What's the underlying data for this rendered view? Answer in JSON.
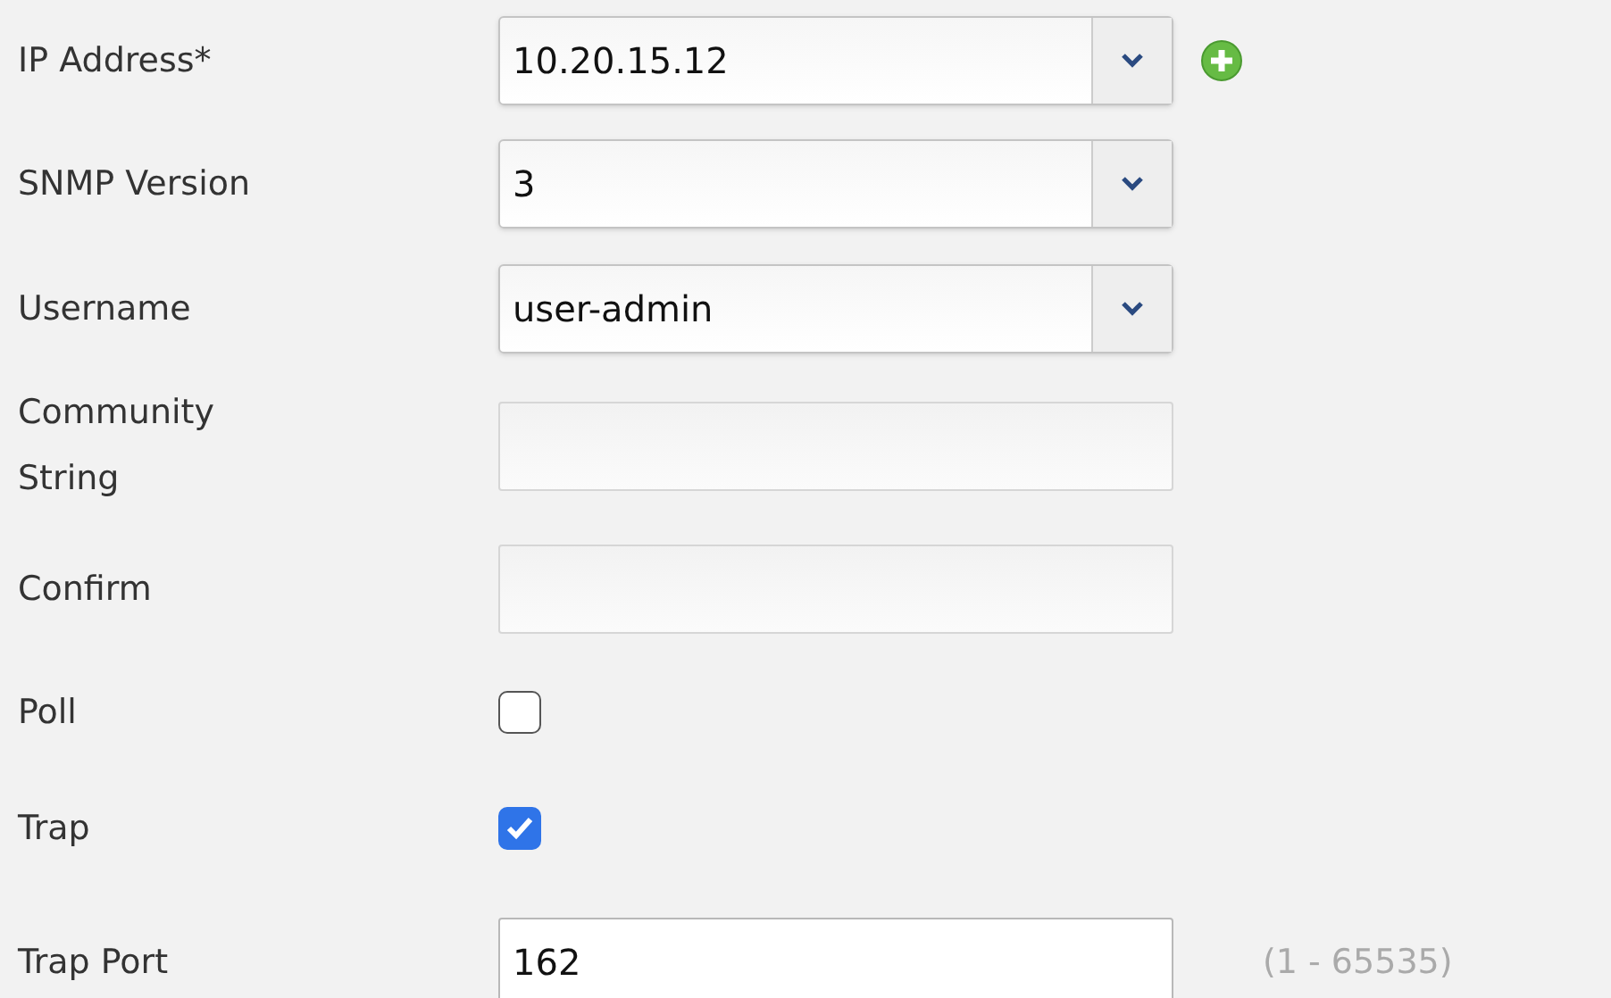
{
  "fields": [
    {
      "kind": "combo",
      "label": "IP Address*",
      "value": "10.20.15.12",
      "add_button": true
    },
    {
      "kind": "combo",
      "label": "SNMP Version",
      "value": "3"
    },
    {
      "kind": "combo",
      "label": "Username",
      "value": "user-admin"
    },
    {
      "kind": "text",
      "label": "Community String"
    },
    {
      "kind": "text",
      "label": "Confirm"
    },
    {
      "kind": "checkbox",
      "label": "Poll",
      "checked": false
    },
    {
      "kind": "checkbox",
      "label": "Trap",
      "checked": true
    },
    {
      "kind": "text",
      "label": "Trap Port",
      "value": "162",
      "hint": "(1 - 65535)"
    }
  ]
}
